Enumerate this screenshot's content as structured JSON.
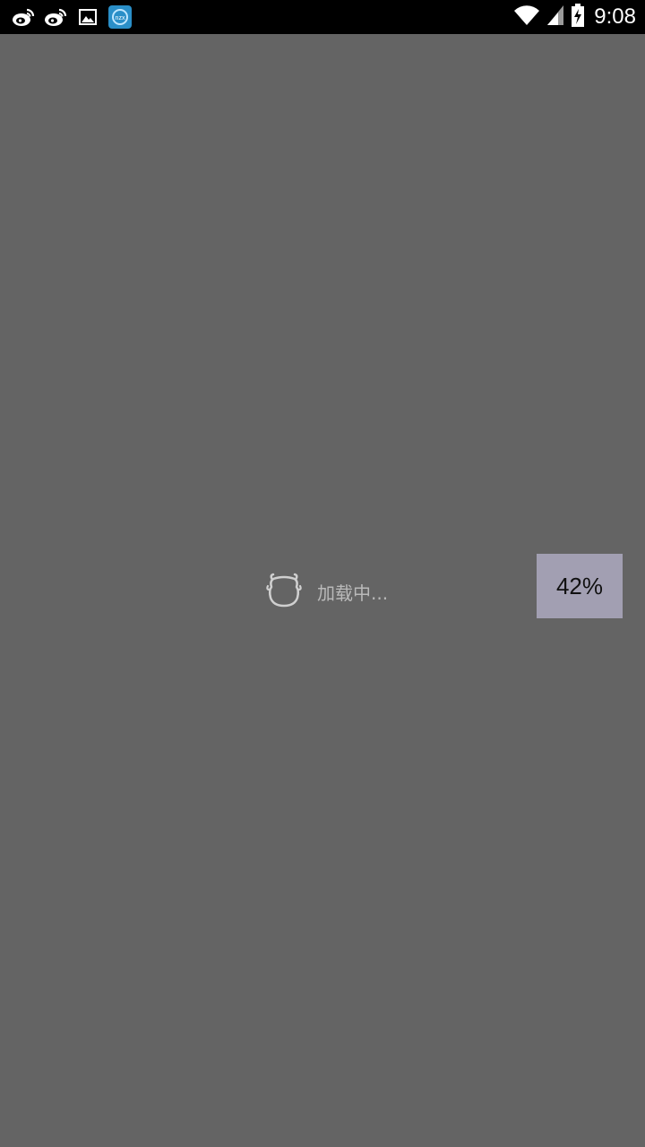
{
  "status_bar": {
    "notification_icons": [
      "weibo-icon",
      "weibo-icon",
      "gallery-icon",
      "app-icon"
    ],
    "system_icons": [
      "wifi-icon",
      "signal-icon",
      "battery-charging-icon"
    ],
    "time": "9:08"
  },
  "loading": {
    "icon": "cow-head-icon",
    "text": "加载中..."
  },
  "progress": {
    "label": "42%",
    "value": 0.42
  },
  "colors": {
    "background": "#646464",
    "status_bar": "#000000",
    "loading_text": "#b9b9b9",
    "percent_box": "#a29fb2"
  }
}
